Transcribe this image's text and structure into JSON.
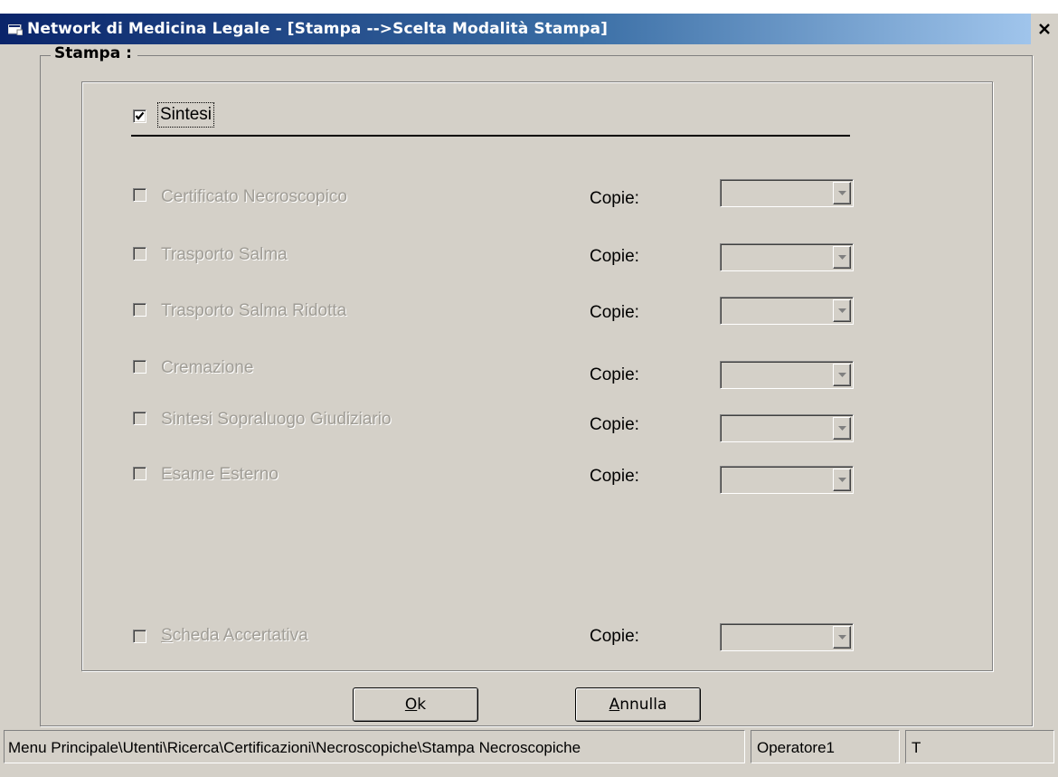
{
  "window": {
    "title": "Network di Medicina Legale - [Stampa -->Scelta Modalità Stampa]",
    "close_glyph": "×"
  },
  "group": {
    "legend": "Stampa :"
  },
  "main_option": {
    "label": "Sintesi",
    "checked": true
  },
  "options": [
    {
      "label": "Certificato Necroscopico",
      "copie_label": "Copie:",
      "copie_value": "",
      "enabled": false,
      "checked": false
    },
    {
      "label": "Trasporto Salma",
      "copie_label": "Copie:",
      "copie_value": "",
      "enabled": false,
      "checked": false
    },
    {
      "label": "Trasporto Salma Ridotta",
      "copie_label": "Copie:",
      "copie_value": "",
      "enabled": false,
      "checked": false
    },
    {
      "label": "Cremazione",
      "copie_label": "Copie:",
      "copie_value": "",
      "enabled": false,
      "checked": false
    },
    {
      "label": "Sintesi Sopraluogo Giudiziario",
      "copie_label": "Copie:",
      "copie_value": "",
      "enabled": false,
      "checked": false
    },
    {
      "label": "Esame Esterno",
      "copie_label": "Copie:",
      "copie_value": "",
      "enabled": false,
      "checked": false
    },
    {
      "label_mnemonic": "S",
      "label_rest": "cheda Accertativa",
      "copie_label": "Copie:",
      "copie_value": "",
      "enabled": false,
      "checked": false
    }
  ],
  "buttons": {
    "ok_mnemonic": "O",
    "ok_rest": "k",
    "annulla_mnemonic": "A",
    "annulla_rest": "nnulla"
  },
  "statusbar": {
    "path": "Menu Principale\\Utenti\\Ricerca\\Certificazioni\\Necroscopiche\\Stampa Necroscopiche",
    "user": "Operatore1",
    "extra": "T"
  },
  "icons": {
    "app": "window-app-icon",
    "close": "close-icon",
    "check": "checkmark-icon",
    "dropdown": "dropdown-arrow-icon"
  },
  "colors": {
    "face": "#d4d0c8",
    "title_start": "#0a246a",
    "title_end": "#a6caf0",
    "disabled_text": "#a09d96"
  }
}
